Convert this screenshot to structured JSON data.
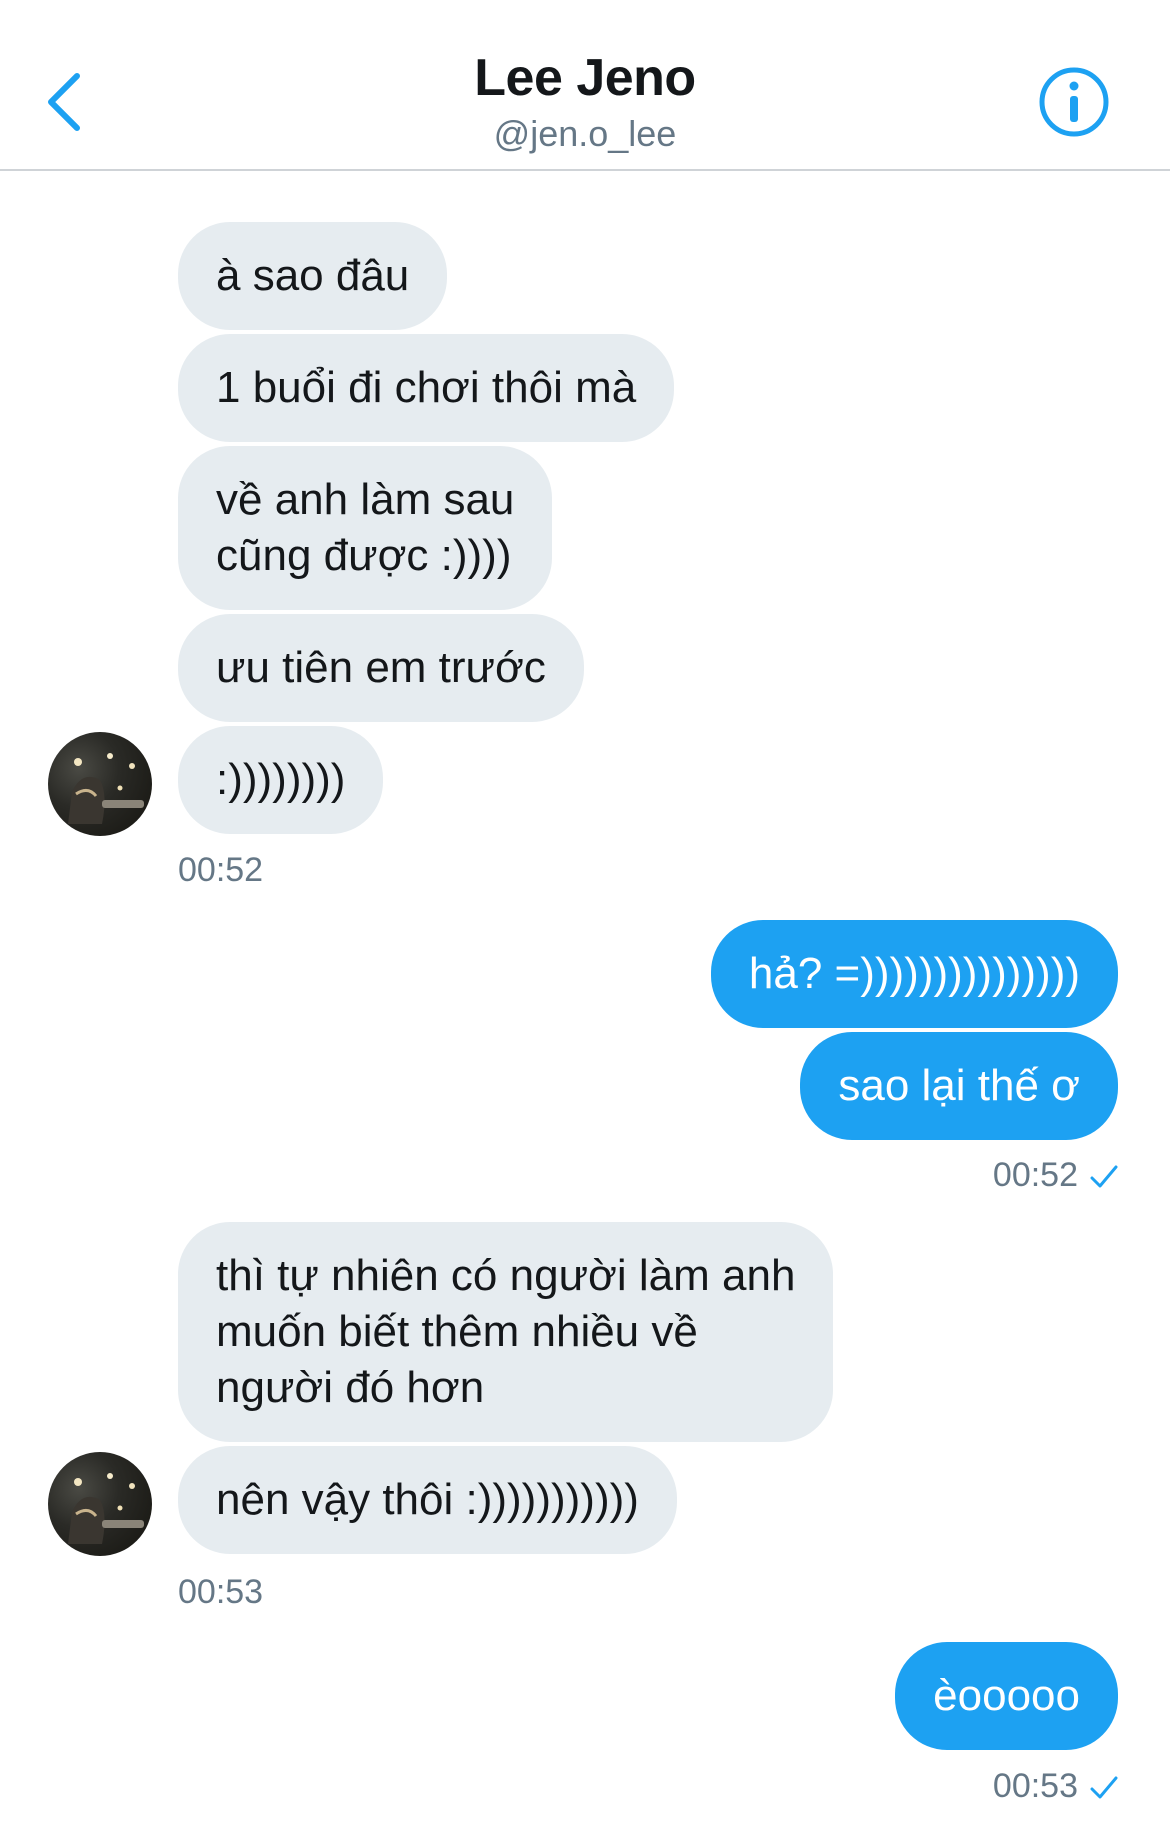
{
  "header": {
    "name": "Lee Jeno",
    "handle": "@jen.o_lee",
    "back_icon": "chevron-left-icon",
    "info_icon": "info-circle-icon"
  },
  "colors": {
    "accent": "#1da1f2",
    "incoming_bubble": "#e6ecf0",
    "timestamp": "#657786"
  },
  "messages": {
    "group1": {
      "m1": "à sao đâu",
      "m2": "1 buổi đi chơi thôi mà",
      "m3_line1": "về anh làm sau",
      "m3_line2": "cũng được :))))",
      "m4": "ưu tiên em trước",
      "m5": ":))))))))",
      "time": "00:52"
    },
    "group2": {
      "m1": "hả? =)))))))))))))))",
      "m2": "sao lại thế ơ",
      "time": "00:52"
    },
    "group3": {
      "m1_line1": "thì tự nhiên có người làm anh",
      "m1_line2": "muốn biết thêm nhiều về",
      "m1_line3": "người đó hơn",
      "m2": "nên vậy thôi :)))))))))))",
      "time": "00:53"
    },
    "group4": {
      "m1": "èooooo",
      "time": "00:53"
    }
  }
}
